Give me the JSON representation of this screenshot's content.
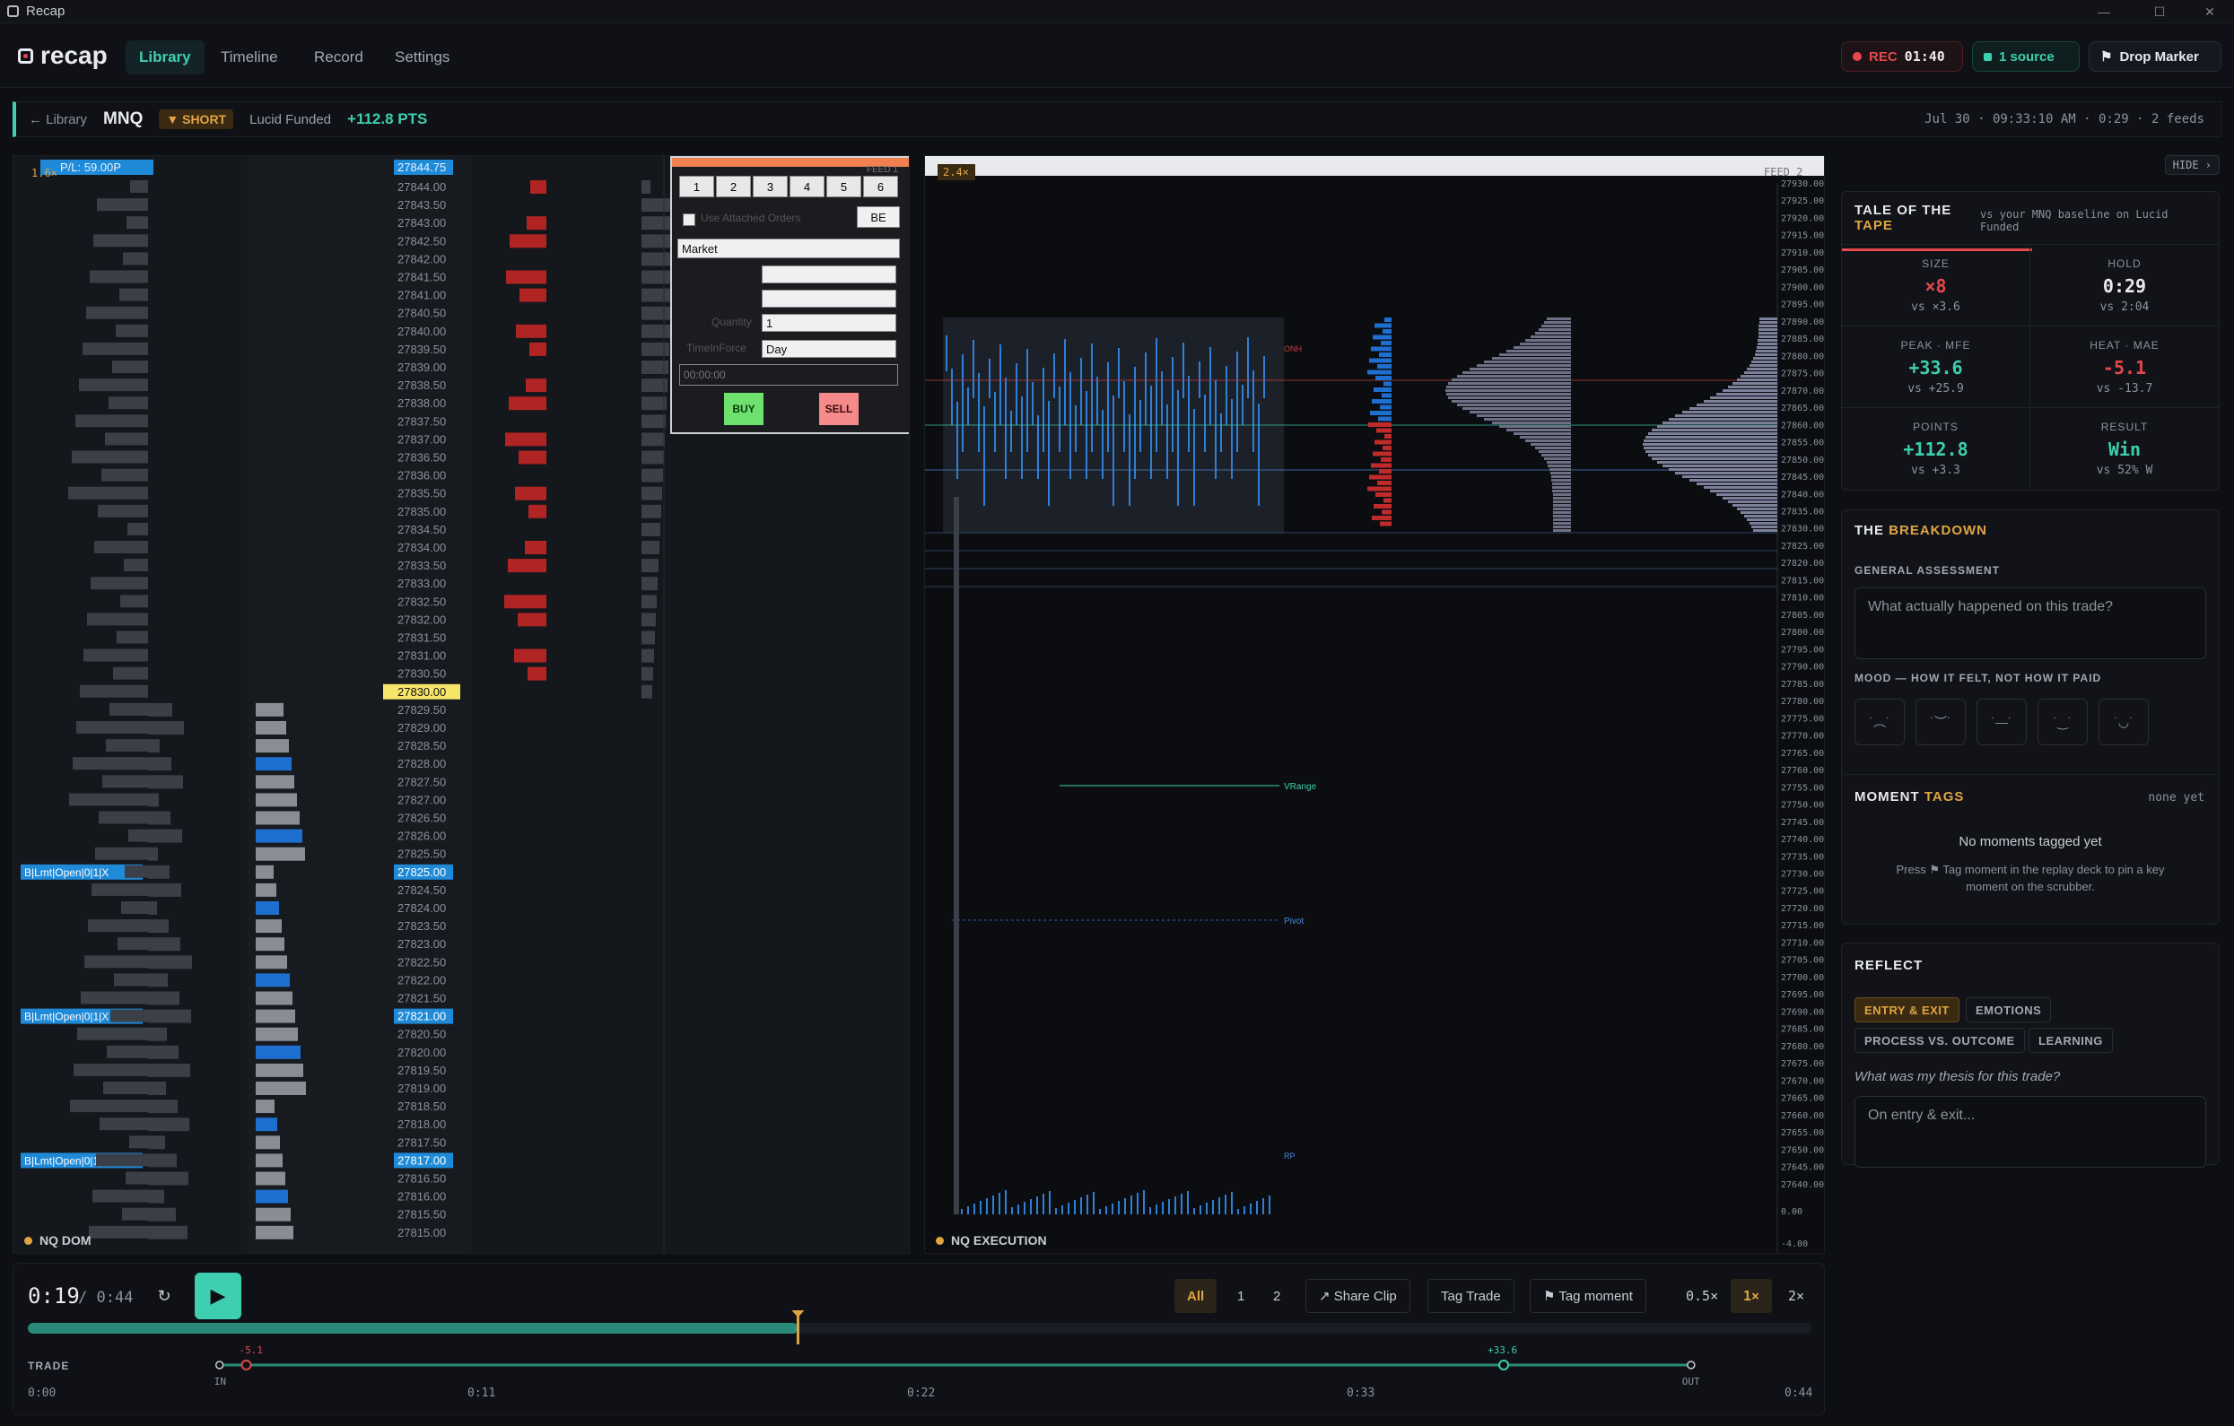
{
  "window": {
    "title": "Recap"
  },
  "nav": {
    "logo": "recap",
    "tabs": [
      "Library",
      "Timeline",
      "Record",
      "Settings"
    ],
    "active_tab": "Library",
    "rec_label": "REC",
    "rec_time": "01:40",
    "source_label": "1 source",
    "drop_marker": "Drop Marker"
  },
  "crumb": {
    "back": "← Library",
    "symbol": "MNQ",
    "direction": "▼ SHORT",
    "account": "Lucid Funded",
    "pnl": "+112.8 PTS",
    "meta": "Jul 30 · 09:33:10 AM · 0:29 · 2 feeds"
  },
  "dom": {
    "label": "NQ DOM",
    "zoom": "1.6×",
    "pl": "P/L: 59.00P",
    "highlight_price": "27830.00",
    "top_price": "27844.75",
    "order_tag": "B|Lmt|Open|0|1|X",
    "order_prices": [
      "27825.00",
      "27821.00",
      "27817.00"
    ],
    "prices": [
      "27844.00",
      "27843.50",
      "27843.00",
      "27842.50",
      "27842.00",
      "27841.50",
      "27841.00",
      "27840.50",
      "27840.00",
      "27839.50",
      "27839.00",
      "27838.50",
      "27838.00",
      "27837.50",
      "27837.00",
      "27836.50",
      "27836.00",
      "27835.50",
      "27835.00",
      "27834.50",
      "27834.00",
      "27833.50",
      "27833.00",
      "27832.50",
      "27832.00",
      "27831.50",
      "27831.00",
      "27830.50",
      "27830.00",
      "27829.50",
      "27829.00",
      "27828.50",
      "27828.00",
      "27827.50",
      "27827.00",
      "27826.50",
      "27826.00",
      "27825.50",
      "27825.00",
      "27824.50",
      "27824.00",
      "27823.50",
      "27823.00",
      "27822.50",
      "27822.00",
      "27821.50",
      "27821.00",
      "27820.50",
      "27820.00",
      "27819.50",
      "27819.00",
      "27818.50",
      "27818.00",
      "27817.50",
      "27817.00",
      "27816.50",
      "27816.00",
      "27815.50",
      "27815.00"
    ],
    "ticket": {
      "qty_buttons": [
        "1",
        "2",
        "3",
        "4",
        "5",
        "6"
      ],
      "attached": "Use Attached Orders",
      "be": "BE",
      "order_type": "Market",
      "quantity_label": "Quantity",
      "quantity": "1",
      "tif_label": "TimeInForce",
      "tif": "Day",
      "time": "00:00:00",
      "buy": "BUY",
      "sell": "SELL",
      "feed": "FEED 1"
    }
  },
  "exec": {
    "label": "NQ EXECUTION",
    "zoom": "2.4×",
    "feed": "FEED 2",
    "annotations": {
      "onh": "ONH",
      "vrange": "VRange",
      "pivot": "Pivot",
      "rp": "RP"
    },
    "axis": [
      "27930.00",
      "27925.00",
      "27920.00",
      "27915.00",
      "27910.00",
      "27905.00",
      "27900.00",
      "27895.00",
      "27890.00",
      "27885.00",
      "27880.00",
      "27875.00",
      "27870.00",
      "27865.00",
      "27860.00",
      "27855.00",
      "27850.00",
      "27845.00",
      "27840.00",
      "27835.00",
      "27830.00",
      "27825.00",
      "27820.00",
      "27815.00",
      "27810.00",
      "27805.00",
      "27800.00",
      "27795.00",
      "27790.00",
      "27785.00",
      "27780.00",
      "27775.00",
      "27770.00",
      "27765.00",
      "27760.00",
      "27755.00",
      "27750.00",
      "27745.00",
      "27740.00",
      "27735.00",
      "27730.00",
      "27725.00",
      "27720.00",
      "27715.00",
      "27710.00",
      "27705.00",
      "27700.00",
      "27695.00",
      "27690.00",
      "27685.00",
      "27680.00",
      "27675.00",
      "27670.00",
      "27665.00",
      "27660.00",
      "27655.00",
      "27650.00",
      "27645.00",
      "27640.00"
    ],
    "sub_axis": [
      "0.00",
      "-4.00"
    ]
  },
  "right": {
    "hide": "HIDE ›",
    "tape": {
      "title_a": "TALE OF THE",
      "title_b": "TAPE",
      "subtitle": "vs your MNQ baseline on Lucid Funded",
      "stats": [
        {
          "label": "SIZE",
          "value": "×8",
          "base": "vs ×3.6",
          "color": "#e5484d"
        },
        {
          "label": "HOLD",
          "value": "0:29",
          "base": "vs 2:04",
          "color": "#e8eaee"
        },
        {
          "label": "PEAK · MFE",
          "value": "+33.6",
          "base": "vs +25.9",
          "color": "#3ecfb0"
        },
        {
          "label": "HEAT · MAE",
          "value": "-5.1",
          "base": "vs -13.7",
          "color": "#e5484d"
        },
        {
          "label": "POINTS",
          "value": "+112.8",
          "base": "vs +3.3",
          "color": "#3ecfb0"
        },
        {
          "label": "RESULT",
          "value": "Win",
          "base": "vs 52% W",
          "color": "#3ecfb0"
        }
      ]
    },
    "breakdown": {
      "title_a": "THE",
      "title_b": "BREAKDOWN",
      "assessment_label": "GENERAL ASSESSMENT",
      "assessment_placeholder": "What actually happened on this trade?",
      "mood_label": "MOOD — HOW IT FELT, NOT HOW IT PAID",
      "moods": [
        "˙︵˙",
        "˙︶˙",
        "˙—˙",
        "˙‿˙",
        "˙◡˙"
      ]
    },
    "moments": {
      "title_a": "MOMENT",
      "title_b": "TAGS",
      "count": "none yet",
      "empty": "No moments tagged yet",
      "hint": "Press ⚑ Tag moment in the replay deck to pin a key moment on the scrubber."
    },
    "reflect": {
      "title": "REFLECT",
      "chips": [
        "ENTRY & EXIT",
        "EMOTIONS",
        "PROCESS VS. OUTCOME",
        "LEARNING"
      ],
      "question": "What was my thesis for this trade?",
      "placeholder": "On entry & exit..."
    }
  },
  "player": {
    "current": "0:19",
    "total": "0:44",
    "progress": 0.4318,
    "feeds": [
      "All",
      "1",
      "2"
    ],
    "share": "↗ Share Clip",
    "tag_trade": "Tag Trade",
    "tag_moment": "⚑ Tag moment",
    "speeds": [
      "0.5×",
      "1×",
      "2×"
    ],
    "trade_label": "TRADE",
    "in_label": "IN",
    "out_label": "OUT",
    "mae": "-5.1",
    "mfe": "+33.6",
    "ticks": [
      "0:00",
      "0:11",
      "0:22",
      "0:33",
      "0:44"
    ]
  },
  "colors": {
    "accent": "#3ecfb0",
    "warn": "#e0a542",
    "bid": "#1e6fd0",
    "ask": "#d12a2a",
    "rec": "#e5484d"
  }
}
